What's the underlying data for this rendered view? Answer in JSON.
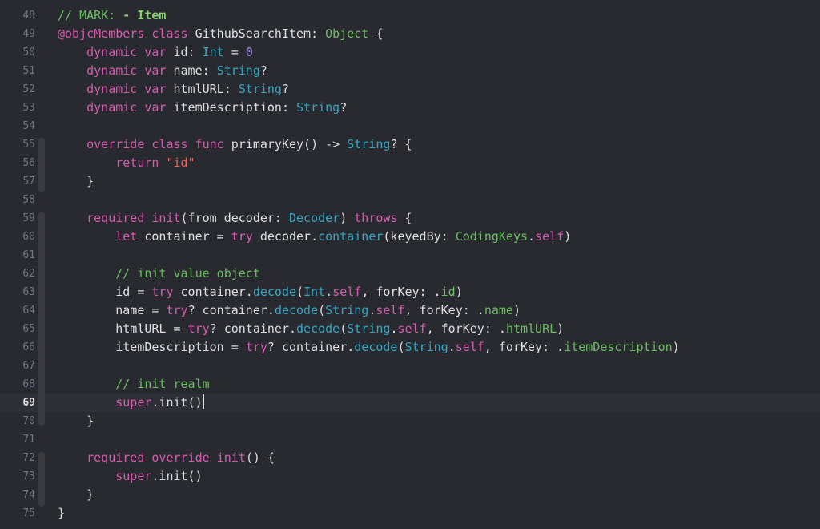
{
  "editor": {
    "current_line": 69,
    "colors": {
      "background": "#292a30",
      "keyword": "#d65cb0",
      "type": "#35a7c2",
      "comment": "#6bbd62",
      "string": "#f0635a",
      "number": "#9e8ae6"
    },
    "lines": [
      {
        "num": "48",
        "tokens": [
          {
            "t": "// MARK: ",
            "c": "cm"
          },
          {
            "t": "- Item",
            "c": "mk"
          }
        ]
      },
      {
        "num": "49",
        "tokens": [
          {
            "t": "@objcMembers",
            "c": "kw"
          },
          {
            "t": " ",
            "c": "id"
          },
          {
            "t": "class",
            "c": "kw"
          },
          {
            "t": " GithubSearchItem: ",
            "c": "id"
          },
          {
            "t": "Object",
            "c": "cm"
          },
          {
            "t": " {",
            "c": "id"
          }
        ]
      },
      {
        "num": "50",
        "tokens": [
          {
            "t": "    ",
            "c": "id"
          },
          {
            "t": "dynamic",
            "c": "kw"
          },
          {
            "t": " ",
            "c": "id"
          },
          {
            "t": "var",
            "c": "kw"
          },
          {
            "t": " id: ",
            "c": "id"
          },
          {
            "t": "Int",
            "c": "ty"
          },
          {
            "t": " = ",
            "c": "id"
          },
          {
            "t": "0",
            "c": "num"
          }
        ]
      },
      {
        "num": "51",
        "tokens": [
          {
            "t": "    ",
            "c": "id"
          },
          {
            "t": "dynamic",
            "c": "kw"
          },
          {
            "t": " ",
            "c": "id"
          },
          {
            "t": "var",
            "c": "kw"
          },
          {
            "t": " name: ",
            "c": "id"
          },
          {
            "t": "String",
            "c": "ty"
          },
          {
            "t": "?",
            "c": "id"
          }
        ]
      },
      {
        "num": "52",
        "tokens": [
          {
            "t": "    ",
            "c": "id"
          },
          {
            "t": "dynamic",
            "c": "kw"
          },
          {
            "t": " ",
            "c": "id"
          },
          {
            "t": "var",
            "c": "kw"
          },
          {
            "t": " htmlURL: ",
            "c": "id"
          },
          {
            "t": "String",
            "c": "ty"
          },
          {
            "t": "?",
            "c": "id"
          }
        ]
      },
      {
        "num": "53",
        "tokens": [
          {
            "t": "    ",
            "c": "id"
          },
          {
            "t": "dynamic",
            "c": "kw"
          },
          {
            "t": " ",
            "c": "id"
          },
          {
            "t": "var",
            "c": "kw"
          },
          {
            "t": " itemDescription: ",
            "c": "id"
          },
          {
            "t": "String",
            "c": "ty"
          },
          {
            "t": "?",
            "c": "id"
          }
        ]
      },
      {
        "num": "54",
        "tokens": []
      },
      {
        "num": "55",
        "tokens": [
          {
            "t": "    ",
            "c": "id"
          },
          {
            "t": "override",
            "c": "kw"
          },
          {
            "t": " ",
            "c": "id"
          },
          {
            "t": "class",
            "c": "kw"
          },
          {
            "t": " ",
            "c": "id"
          },
          {
            "t": "func",
            "c": "kw"
          },
          {
            "t": " primaryKey() -> ",
            "c": "id"
          },
          {
            "t": "String",
            "c": "ty"
          },
          {
            "t": "? {",
            "c": "id"
          }
        ]
      },
      {
        "num": "56",
        "tokens": [
          {
            "t": "        ",
            "c": "id"
          },
          {
            "t": "return",
            "c": "kw"
          },
          {
            "t": " ",
            "c": "id"
          },
          {
            "t": "\"id\"",
            "c": "str"
          }
        ]
      },
      {
        "num": "57",
        "tokens": [
          {
            "t": "    }",
            "c": "id"
          }
        ]
      },
      {
        "num": "58",
        "tokens": []
      },
      {
        "num": "59",
        "tokens": [
          {
            "t": "    ",
            "c": "id"
          },
          {
            "t": "required",
            "c": "kw"
          },
          {
            "t": " ",
            "c": "id"
          },
          {
            "t": "init",
            "c": "kw"
          },
          {
            "t": "(from decoder: ",
            "c": "id"
          },
          {
            "t": "Decoder",
            "c": "ty"
          },
          {
            "t": ") ",
            "c": "id"
          },
          {
            "t": "throws",
            "c": "kw"
          },
          {
            "t": " {",
            "c": "id"
          }
        ]
      },
      {
        "num": "60",
        "tokens": [
          {
            "t": "        ",
            "c": "id"
          },
          {
            "t": "let",
            "c": "kw"
          },
          {
            "t": " container = ",
            "c": "id"
          },
          {
            "t": "try",
            "c": "kw"
          },
          {
            "t": " decoder.",
            "c": "id"
          },
          {
            "t": "container",
            "c": "ty"
          },
          {
            "t": "(keyedBy: ",
            "c": "id"
          },
          {
            "t": "CodingKeys",
            "c": "cm"
          },
          {
            "t": ".",
            "c": "id"
          },
          {
            "t": "self",
            "c": "kw"
          },
          {
            "t": ")",
            "c": "id"
          }
        ]
      },
      {
        "num": "61",
        "tokens": []
      },
      {
        "num": "62",
        "tokens": [
          {
            "t": "        ",
            "c": "id"
          },
          {
            "t": "// init value object",
            "c": "cm"
          }
        ]
      },
      {
        "num": "63",
        "tokens": [
          {
            "t": "        id = ",
            "c": "id"
          },
          {
            "t": "try",
            "c": "kw"
          },
          {
            "t": " container.",
            "c": "id"
          },
          {
            "t": "decode",
            "c": "ty"
          },
          {
            "t": "(",
            "c": "id"
          },
          {
            "t": "Int",
            "c": "ty"
          },
          {
            "t": ".",
            "c": "id"
          },
          {
            "t": "self",
            "c": "kw"
          },
          {
            "t": ", forKey: .",
            "c": "id"
          },
          {
            "t": "id",
            "c": "cm"
          },
          {
            "t": ")",
            "c": "id"
          }
        ]
      },
      {
        "num": "64",
        "tokens": [
          {
            "t": "        name = ",
            "c": "id"
          },
          {
            "t": "try",
            "c": "kw"
          },
          {
            "t": "? container.",
            "c": "id"
          },
          {
            "t": "decode",
            "c": "ty"
          },
          {
            "t": "(",
            "c": "id"
          },
          {
            "t": "String",
            "c": "ty"
          },
          {
            "t": ".",
            "c": "id"
          },
          {
            "t": "self",
            "c": "kw"
          },
          {
            "t": ", forKey: .",
            "c": "id"
          },
          {
            "t": "name",
            "c": "cm"
          },
          {
            "t": ")",
            "c": "id"
          }
        ]
      },
      {
        "num": "65",
        "tokens": [
          {
            "t": "        htmlURL = ",
            "c": "id"
          },
          {
            "t": "try",
            "c": "kw"
          },
          {
            "t": "? container.",
            "c": "id"
          },
          {
            "t": "decode",
            "c": "ty"
          },
          {
            "t": "(",
            "c": "id"
          },
          {
            "t": "String",
            "c": "ty"
          },
          {
            "t": ".",
            "c": "id"
          },
          {
            "t": "self",
            "c": "kw"
          },
          {
            "t": ", forKey: .",
            "c": "id"
          },
          {
            "t": "htmlURL",
            "c": "cm"
          },
          {
            "t": ")",
            "c": "id"
          }
        ]
      },
      {
        "num": "66",
        "tokens": [
          {
            "t": "        itemDescription = ",
            "c": "id"
          },
          {
            "t": "try",
            "c": "kw"
          },
          {
            "t": "? container.",
            "c": "id"
          },
          {
            "t": "decode",
            "c": "ty"
          },
          {
            "t": "(",
            "c": "id"
          },
          {
            "t": "String",
            "c": "ty"
          },
          {
            "t": ".",
            "c": "id"
          },
          {
            "t": "self",
            "c": "kw"
          },
          {
            "t": ", forKey: .",
            "c": "id"
          },
          {
            "t": "itemDescription",
            "c": "cm"
          },
          {
            "t": ")",
            "c": "id"
          }
        ]
      },
      {
        "num": "67",
        "tokens": []
      },
      {
        "num": "68",
        "tokens": [
          {
            "t": "        ",
            "c": "id"
          },
          {
            "t": "// init realm",
            "c": "cm"
          }
        ]
      },
      {
        "num": "69",
        "tokens": [
          {
            "t": "        ",
            "c": "id"
          },
          {
            "t": "super",
            "c": "kw"
          },
          {
            "t": ".init()",
            "c": "id"
          }
        ]
      },
      {
        "num": "70",
        "tokens": [
          {
            "t": "    }",
            "c": "id"
          }
        ]
      },
      {
        "num": "71",
        "tokens": []
      },
      {
        "num": "72",
        "tokens": [
          {
            "t": "    ",
            "c": "id"
          },
          {
            "t": "required",
            "c": "kw"
          },
          {
            "t": " ",
            "c": "id"
          },
          {
            "t": "override",
            "c": "kw"
          },
          {
            "t": " ",
            "c": "id"
          },
          {
            "t": "init",
            "c": "kw"
          },
          {
            "t": "() {",
            "c": "id"
          }
        ]
      },
      {
        "num": "73",
        "tokens": [
          {
            "t": "        ",
            "c": "id"
          },
          {
            "t": "super",
            "c": "kw"
          },
          {
            "t": ".init()",
            "c": "id"
          }
        ]
      },
      {
        "num": "74",
        "tokens": [
          {
            "t": "    }",
            "c": "id"
          }
        ]
      },
      {
        "num": "75",
        "tokens": [
          {
            "t": "}",
            "c": "id"
          }
        ]
      }
    ]
  }
}
